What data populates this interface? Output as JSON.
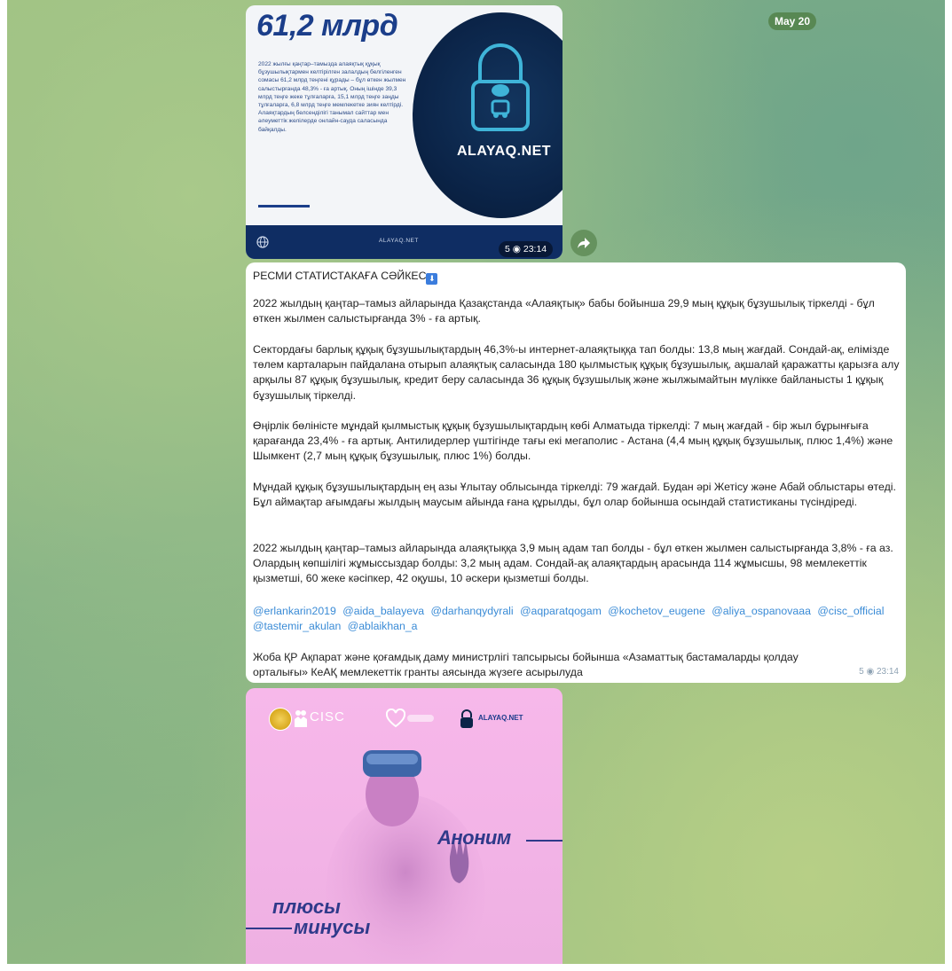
{
  "date_badge": "May 20",
  "post1": {
    "title": "61,2 млрд",
    "body": "2022 жылғы қаңтар–тамызда алаяқтық құқық бұзушылықтармен келтірілген залалдың белгіленген сомасы 61,2 млрд теңгені құрады – бұл өткен жылмен салыстырғанда 48,3% - ға артық. Оның ішінде 39,3 млрд теңге жеке тұлғаларға, 15,1 млрд теңге заңды тұлғаларға, 6,8 млрд теңге мемлекетке зиян келтірді. Алаяқтардың белсенділігі танымал сайттар мен әлеуметтік желілерде онлайн-сауда саласында байқалды.",
    "brand": "ALAYAQ.NET",
    "footer_brand": "ALAYAQ.NET",
    "views": "5",
    "time": "23:14"
  },
  "post2": {
    "header": "РЕСМИ СТАТИСТАКАҒА СӘЙКЕС",
    "header_emoji": "⬇",
    "p1": "2022 жылдың қаңтар–тамыз айларында Қазақстанда «Алаяқтық» бабы бойынша 29,9 мың құқық бұзушылық тіркелді - бұл өткен жылмен салыстырғанда 3% - ға артық.",
    "p2": "Сектордағы барлық құқық бұзушылықтардың 46,3%-ы интернет-алаяқтыққа тап болды: 13,8 мың жағдай. Сондай-ақ, елімізде төлем карталарын пайдалана отырып алаяқтық саласында 180 қылмыстық құқық бұзушылық, ақшалай қаражатты қарызға алу арқылы 87 құқық бұзушылық, кредит беру саласында 36 құқық бұзушылық және жылжымайтын мүлікке байланысты 1 құқық бұзушылық тіркелді.",
    "p3": "Өңірлік бөліністе мұндай қылмыстық құқық бұзушылықтардың көбі Алматыда тіркелді: 7 мың жағдай - бір жыл бұрынғыға қарағанда 23,4% - ға артық. Антилидерлер үштігінде тағы екі мегаполис - Астана (4,4 мың құқық бұзушылық, плюс 1,4%) және Шымкент (2,7 мың құқық бұзушылық, плюс 1%) болды.",
    "p4": "Мұндай құқық бұзушылықтардың ең азы Ұлытау облысында тіркелді: 79 жағдай. Будан әрі Жетісу және Абай облыстары өтеді. Бұл аймақтар ағымдағы жылдың маусым айында ғана құрылды, бұл олар бойынша осындай статистиканы түсіндіреді.",
    "p5": "2022 жылдың қаңтар–тамыз айларында алаяқтыққа 3,9 мың адам тап болды - бұл өткен жылмен салыстырғанда 3,8% - ға аз. Олардың көпшілігі жұмыссыздар болды: 3,2 мың адам. Сондай-ақ алаяқтардың арасында 114 жұмысшы, 98 мемлекеттік қызметші, 60 жеке кәсіпкер, 42 оқушы, 10 әскери қызметші болды.",
    "mentions": [
      "@erlankarin2019",
      "@aida_balayeva",
      "@darhanqydyrali",
      "@aqparatqogam",
      "@kochetov_eugene",
      "@aliya_ospanovaaa",
      "@cisc_official",
      "@tastemir_akulan",
      "@ablaikhan_a"
    ],
    "p6": "Жоба ҚР Ақпарат және қоғамдық даму министрлігі тапсырысы бойынша «Азаматтық бастамаларды қолдау орталығы» КеАҚ мемлекеттік гранты аясында жүзеге асырылуда",
    "views": "5",
    "time": "23:14"
  },
  "post3": {
    "logo_text": "CISC",
    "brand": "ALAYAQ.NET",
    "word_anon": "Аноним",
    "word_plus": "плюсы",
    "word_minus": "минусы"
  },
  "colors": {
    "accent_blue": "#1b3e8a",
    "link": "#3a8bd6",
    "chat_green": "#8db47c"
  }
}
